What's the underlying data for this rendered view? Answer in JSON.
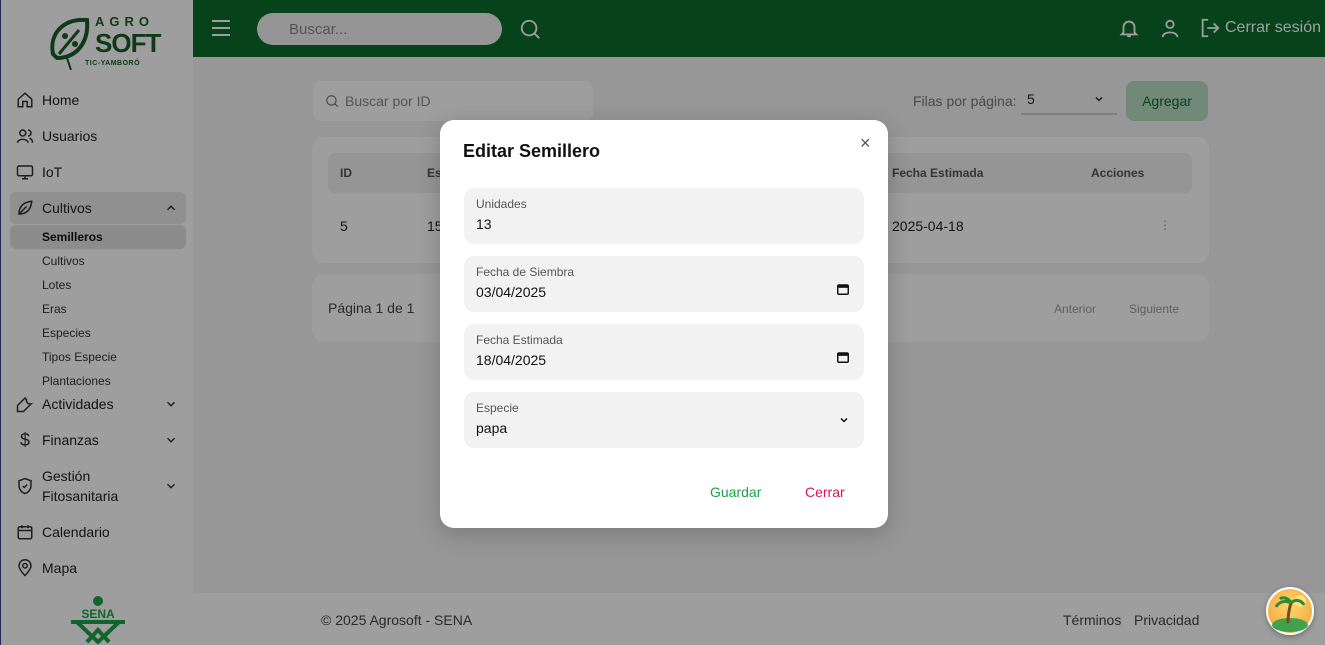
{
  "brand": {
    "line1": "AGRO",
    "line2": "SOFT",
    "line3": "TIC-YAMBORÓ"
  },
  "header": {
    "search_placeholder": "Buscar...",
    "logout_label": "Cerrar sesión"
  },
  "sidebar": {
    "items": [
      {
        "label": "Home"
      },
      {
        "label": "Usuarios"
      },
      {
        "label": "IoT"
      },
      {
        "label": "Cultivos"
      },
      {
        "label": "Actividades"
      },
      {
        "label": "Finanzas"
      },
      {
        "label": "Gestión Fitosanitaria"
      },
      {
        "label": "Calendario"
      },
      {
        "label": "Mapa"
      }
    ],
    "subitems": [
      "Semilleros",
      "Cultivos",
      "Lotes",
      "Eras",
      "Especies",
      "Tipos Especie",
      "Plantaciones"
    ]
  },
  "main": {
    "search_placeholder": "Buscar por ID",
    "rows_label": "Filas por página:",
    "rows_value": "5",
    "add_label": "Agregar",
    "table": {
      "headers": [
        "ID",
        "Esp",
        "Fecha Estimada",
        "Acciones"
      ],
      "row": {
        "id": "5",
        "esp": "15",
        "fecha": "2025-04-18",
        "acciones": "⋮"
      }
    },
    "pager": {
      "info": "Página 1 de 1",
      "prev": "Anterior",
      "next": "Siguiente"
    }
  },
  "footer": {
    "copyright": "© 2025 Agrosoft - SENA",
    "terms": "Términos",
    "privacy": "Privacidad"
  },
  "modal": {
    "title": "Editar Semillero",
    "close": "×",
    "fields": [
      {
        "label": "Unidades",
        "value": "13"
      },
      {
        "label": "Fecha de Siembra",
        "value": "03/04/2025"
      },
      {
        "label": "Fecha Estimada",
        "value": "18/04/2025"
      },
      {
        "label": "Especie",
        "value": "papa"
      }
    ],
    "save_label": "Guardar",
    "cancel_label": "Cerrar"
  },
  "colors": {
    "primary": "#0b6b2a",
    "save": "#1aa34a",
    "cancel": "#d4145a"
  }
}
